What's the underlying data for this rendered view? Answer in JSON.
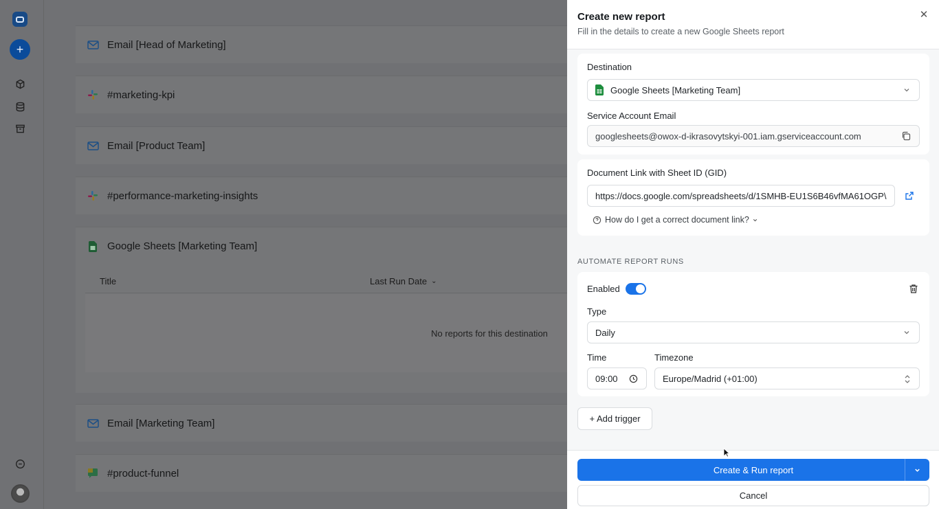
{
  "sidebar": {
    "icons": [
      "app-logo-icon",
      "new-icon",
      "cube-icon",
      "database-icon",
      "archive-icon",
      "chat-icon",
      "avatar"
    ]
  },
  "background_list": {
    "rows": [
      {
        "label": "Email [Head of Marketing]",
        "icon": "mail-icon"
      },
      {
        "label": "#marketing-kpi",
        "icon": "slack-icon"
      },
      {
        "label": "Email [Product Team]",
        "icon": "mail-icon"
      },
      {
        "label": "#performance-marketing-insights",
        "icon": "slack-icon"
      },
      {
        "label": "Email [Marketing Team]",
        "icon": "mail-icon"
      },
      {
        "label": "#product-funnel",
        "icon": "chat-icon"
      }
    ],
    "sheets_block": {
      "label": "Google Sheets [Marketing Team]",
      "col_title": "Title",
      "col_last_run": "Last Run Date",
      "empty_text": "No reports for this destination"
    }
  },
  "panel": {
    "title": "Create new report",
    "subtitle": "Fill in the details to create a new Google Sheets report",
    "destination_label": "Destination",
    "destination_value": "Google Sheets [Marketing Team]",
    "service_email_label": "Service Account Email",
    "service_email_value": "googlesheets@owox-d-ikrasovytskyi-001.iam.gserviceaccount.com",
    "doc_link_label": "Document Link with Sheet ID (GID)",
    "doc_link_value": "https://docs.google.com/spreadsheets/d/1SMHB-EU1S6B46vfMA61OGP\\",
    "help_link": "How do I get a correct document link?",
    "automate_title": "AUTOMATE REPORT RUNS",
    "enabled_label": "Enabled",
    "enabled": true,
    "type_label": "Type",
    "type_value": "Daily",
    "time_label": "Time",
    "time_value": "09:00",
    "timezone_label": "Timezone",
    "timezone_value": "Europe/Madrid (+01:00)",
    "add_trigger": "+ Add trigger",
    "create_button": "Create & Run report",
    "cancel_button": "Cancel"
  },
  "colors": {
    "accent": "#1a73e8",
    "sheets_green": "#1e8e3e"
  }
}
